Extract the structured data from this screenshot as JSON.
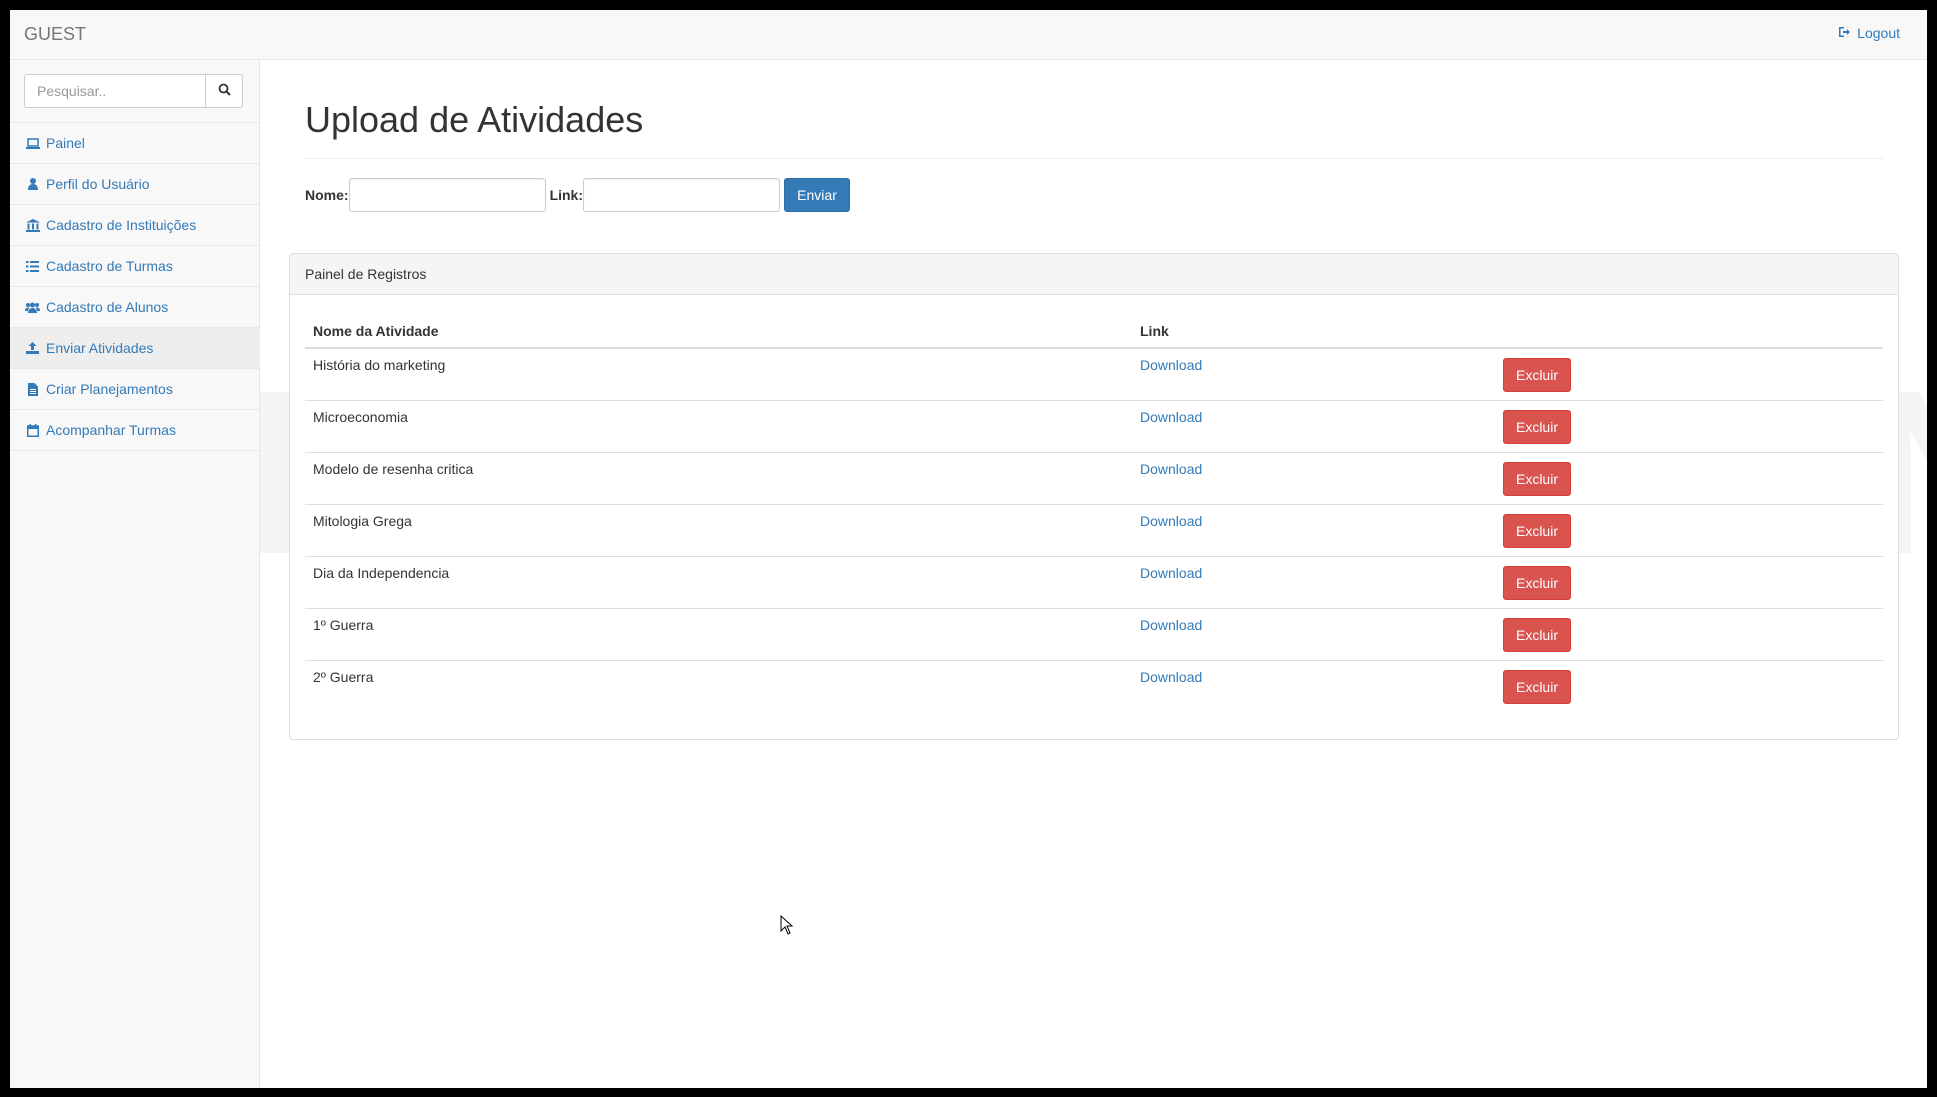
{
  "navbar": {
    "brand": "GUEST",
    "logout_label": "Logout",
    "logout_icon": "sign-out-icon"
  },
  "sidebar": {
    "search": {
      "placeholder": "Pesquisar..",
      "value": "",
      "button_icon": "search-icon"
    },
    "items": [
      {
        "label": "Painel",
        "icon": "laptop-icon",
        "active": false
      },
      {
        "label": "Perfil do Usuário",
        "icon": "user-icon",
        "active": false
      },
      {
        "label": "Cadastro de Instituições",
        "icon": "bank-icon",
        "active": false
      },
      {
        "label": "Cadastro de Turmas",
        "icon": "list-icon",
        "active": false
      },
      {
        "label": "Cadastro de Alunos",
        "icon": "users-icon",
        "active": false
      },
      {
        "label": "Enviar Atividades",
        "icon": "upload-icon",
        "active": true
      },
      {
        "label": "Criar Planejamentos",
        "icon": "file-text-icon",
        "active": false
      },
      {
        "label": "Acompanhar Turmas",
        "icon": "calendar-icon",
        "active": false
      }
    ]
  },
  "main": {
    "title": "Upload de Atividades",
    "form": {
      "name_label": "Nome:",
      "name_value": "",
      "link_label": "Link:",
      "link_value": "",
      "submit_label": "Enviar"
    },
    "panel": {
      "heading": "Painel de Registros",
      "columns": [
        "Nome da Atividade",
        "Link",
        ""
      ],
      "rows": [
        {
          "name": "História do marketing",
          "link": "Download",
          "action": "Excluir"
        },
        {
          "name": "Microeconomia",
          "link": "Download",
          "action": "Excluir"
        },
        {
          "name": "Modelo de resenha critica",
          "link": "Download",
          "action": "Excluir"
        },
        {
          "name": "Mitologia Grega",
          "link": "Download",
          "action": "Excluir"
        },
        {
          "name": "Dia da Independencia",
          "link": "Download",
          "action": "Excluir"
        },
        {
          "name": "1º Guerra",
          "link": "Download",
          "action": "Excluir"
        },
        {
          "name": "2º Guerra",
          "link": "Download",
          "action": "Excluir"
        }
      ]
    }
  },
  "watermark": "DEMO VERSION",
  "colors": {
    "link": "#337ab7",
    "primary": "#337ab7",
    "danger": "#d9534f",
    "sidebar_bg": "#f8f8f8",
    "active_item_bg": "#eeeeee"
  }
}
